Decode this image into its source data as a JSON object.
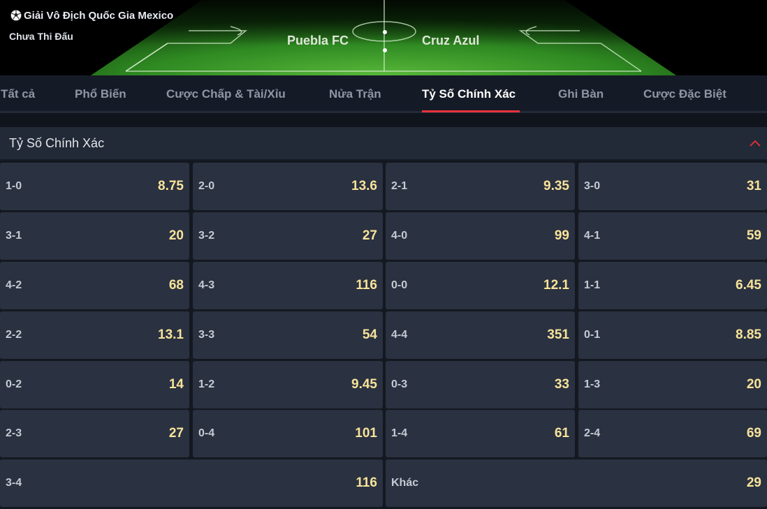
{
  "match": {
    "league": "Giải Vô Địch Quốc Gia Mexico",
    "status": "Chưa Thi Đấu",
    "home_team": "Puebla FC",
    "away_team": "Cruz Azul",
    "league_icon": "soccer-ball-icon"
  },
  "tabs": [
    {
      "label": "Tất cả",
      "active": false
    },
    {
      "label": "Phổ Biến",
      "active": false
    },
    {
      "label": "Cược Chấp & Tài/Xỉu",
      "active": false
    },
    {
      "label": "Nửa Trận",
      "active": false
    },
    {
      "label": "Tỷ Số Chính Xác",
      "active": true
    },
    {
      "label": "Ghi Bàn",
      "active": false
    },
    {
      "label": "Cược Đặc Biệt",
      "active": false
    }
  ],
  "section": {
    "title": "Tỷ Số Chính Xác",
    "collapse_icon": "chevron-up-icon"
  },
  "scores": [
    {
      "score": "1-0",
      "odd": "8.75"
    },
    {
      "score": "2-0",
      "odd": "13.6"
    },
    {
      "score": "2-1",
      "odd": "9.35"
    },
    {
      "score": "3-0",
      "odd": "31"
    },
    {
      "score": "3-1",
      "odd": "20"
    },
    {
      "score": "3-2",
      "odd": "27"
    },
    {
      "score": "4-0",
      "odd": "99"
    },
    {
      "score": "4-1",
      "odd": "59"
    },
    {
      "score": "4-2",
      "odd": "68"
    },
    {
      "score": "4-3",
      "odd": "116"
    },
    {
      "score": "0-0",
      "odd": "12.1"
    },
    {
      "score": "1-1",
      "odd": "6.45"
    },
    {
      "score": "2-2",
      "odd": "13.1"
    },
    {
      "score": "3-3",
      "odd": "54"
    },
    {
      "score": "4-4",
      "odd": "351"
    },
    {
      "score": "0-1",
      "odd": "8.85"
    },
    {
      "score": "0-2",
      "odd": "14"
    },
    {
      "score": "1-2",
      "odd": "9.45"
    },
    {
      "score": "0-3",
      "odd": "33"
    },
    {
      "score": "1-3",
      "odd": "20"
    },
    {
      "score": "2-3",
      "odd": "27"
    },
    {
      "score": "0-4",
      "odd": "101"
    },
    {
      "score": "1-4",
      "odd": "61"
    },
    {
      "score": "2-4",
      "odd": "69"
    },
    {
      "score": "3-4",
      "odd": "116"
    },
    {
      "score": "Khác",
      "odd": "29"
    }
  ],
  "colors": {
    "accent": "#e8323c",
    "odd_text": "#f7e39a",
    "cell_bg": "#2a3140",
    "pitch_green": "#3a8a2a"
  }
}
